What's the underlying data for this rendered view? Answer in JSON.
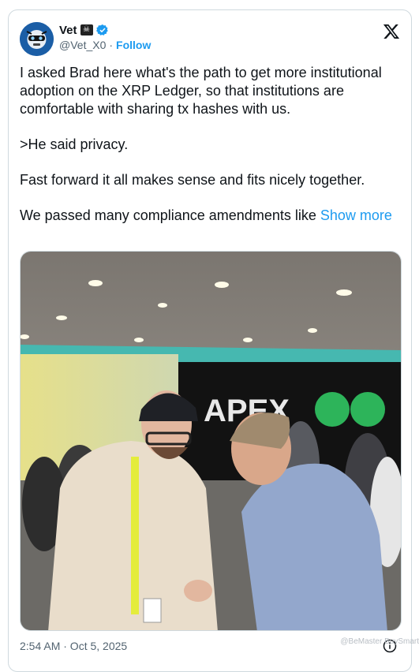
{
  "author": {
    "name": "Vet",
    "handle": "@Vet_X0",
    "separator": "·",
    "follow_label": "Follow",
    "badge_emoji": "☠",
    "verified_color": "#1d9bf0"
  },
  "post": {
    "paragraphs": [
      "I asked Brad here what's the path to get more institutional adoption on the XRP Ledger, so that institutions are comfortable with sharing tx hashes with us.",
      ">He said privacy.",
      "Fast forward it all makes sense and fits nicely together."
    ],
    "last_paragraph": "We passed many compliance amendments like ",
    "show_more": "Show more",
    "photo_sign": "APEX"
  },
  "timestamp": "2:54 AM · Oct 5, 2025",
  "watermark": "@BeMaster BuySmart",
  "icons": {
    "brand": "x-logo-icon",
    "verified": "verified-badge-icon",
    "info": "info-icon"
  },
  "colors": {
    "accent": "#1d9bf0",
    "text": "#0f1419",
    "secondary": "#536471",
    "border": "#cfd9de"
  }
}
